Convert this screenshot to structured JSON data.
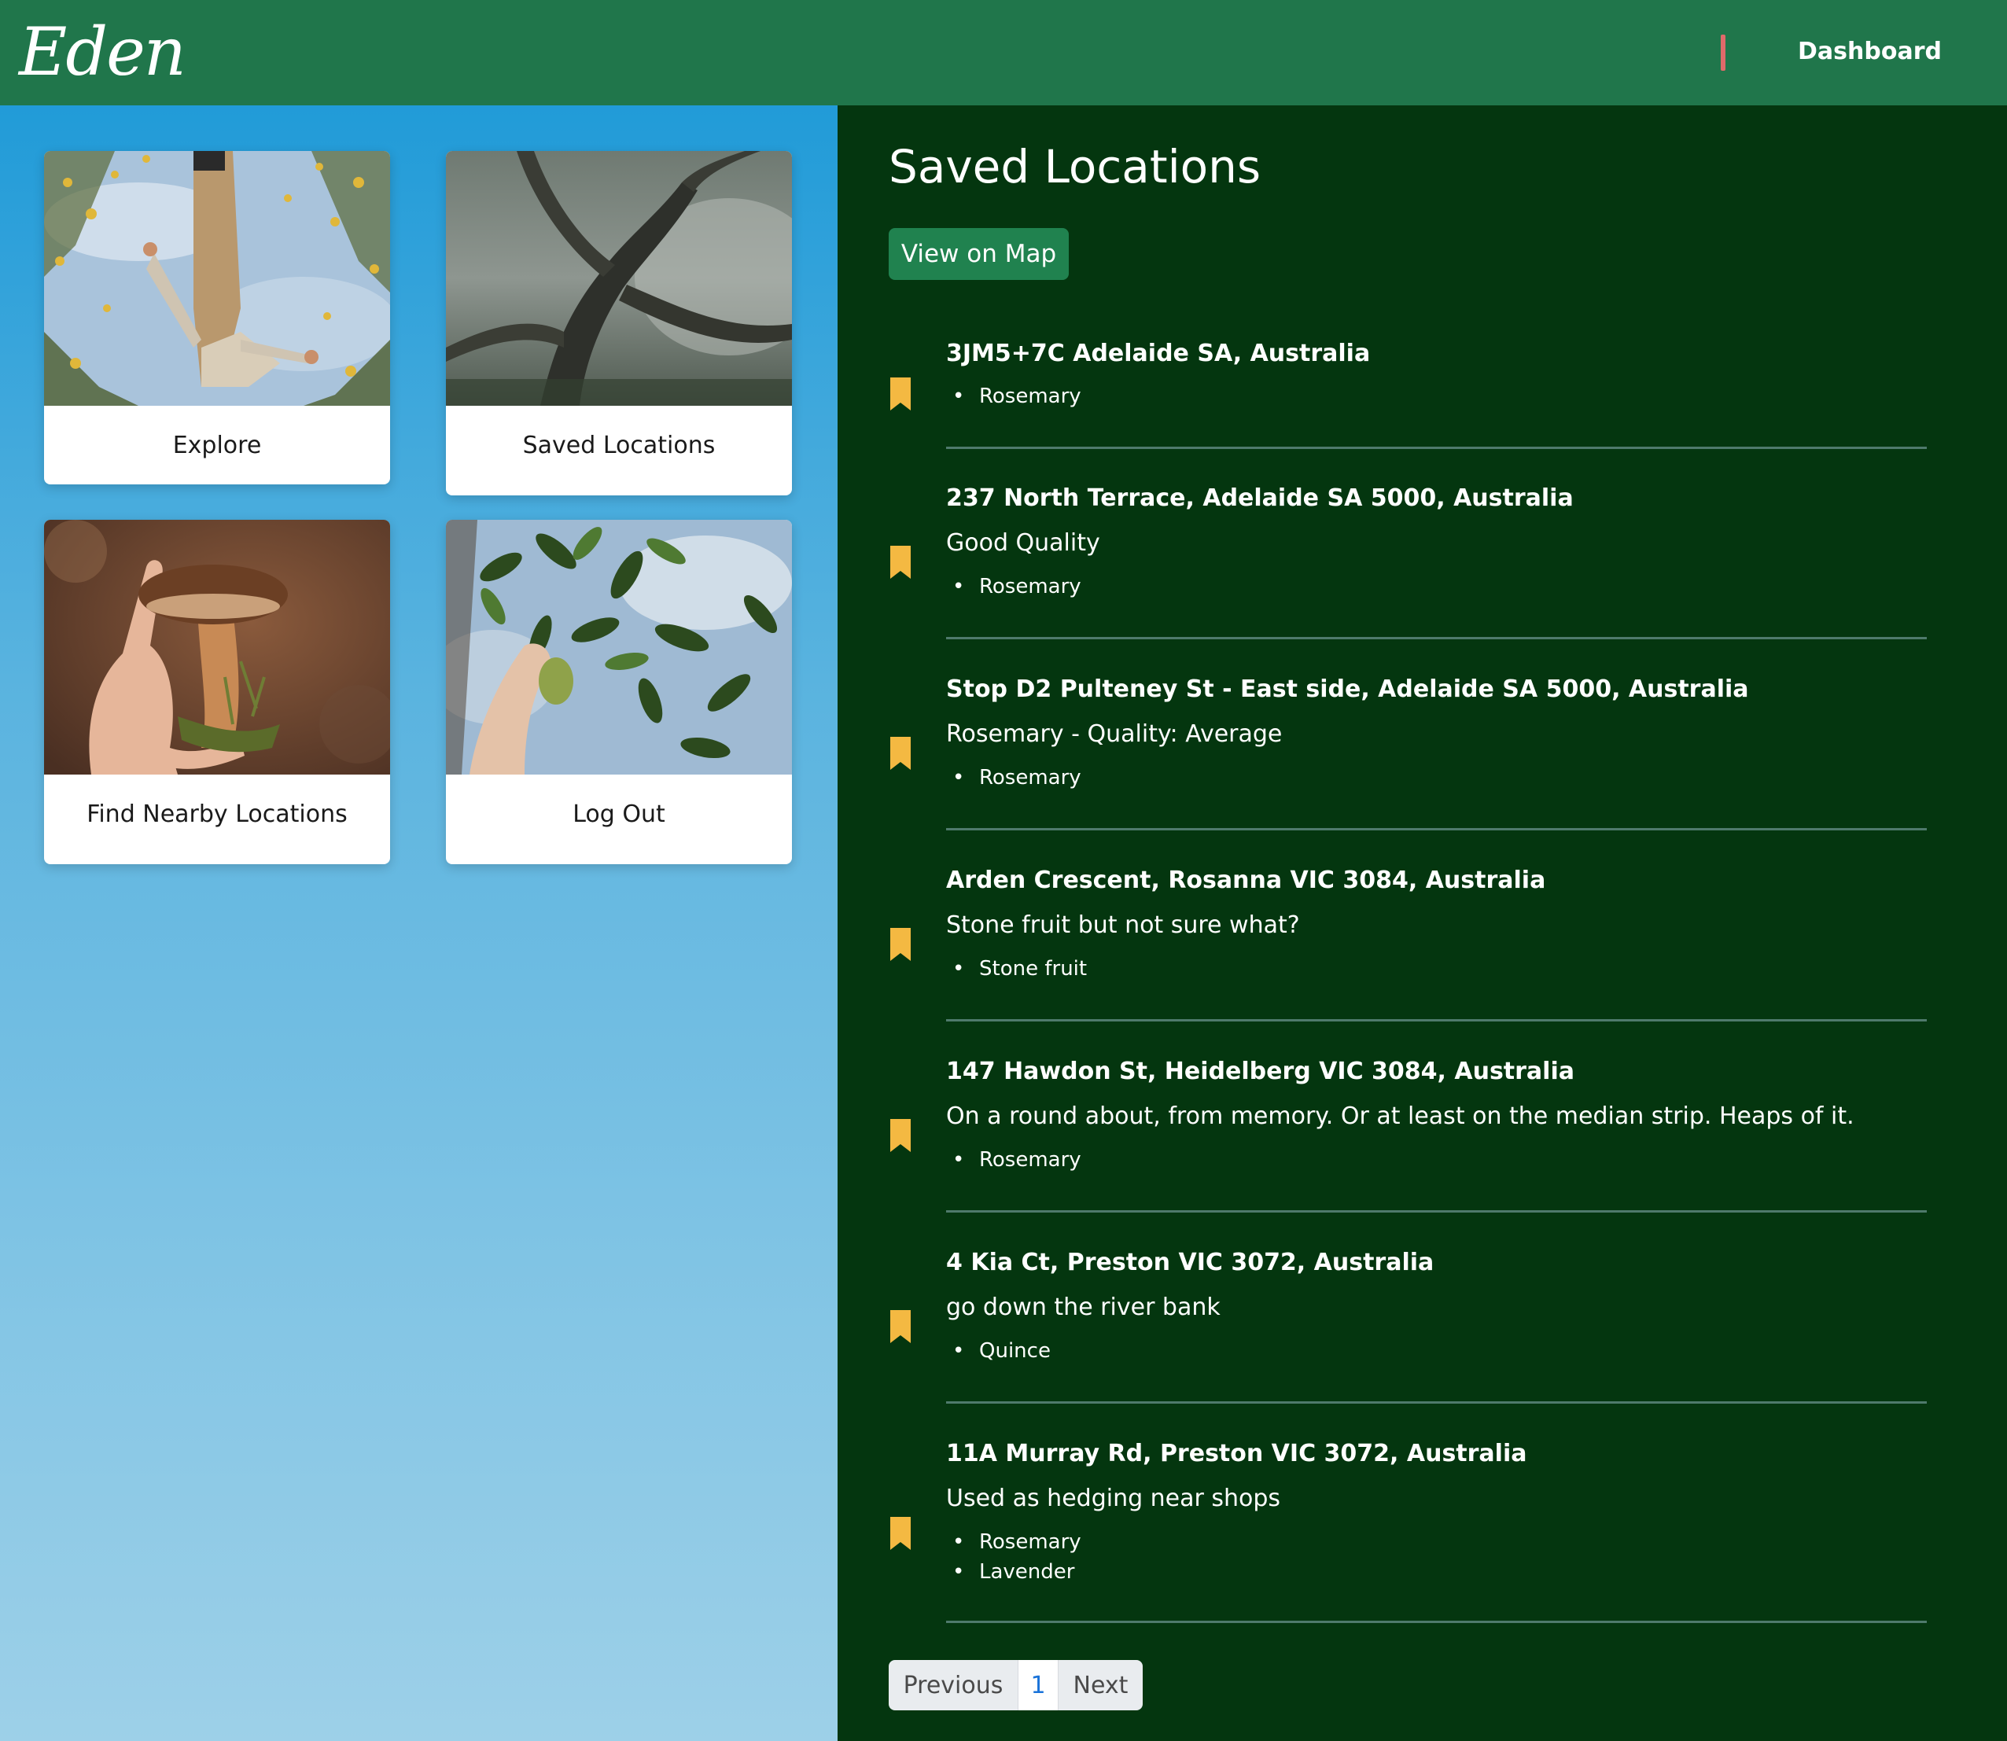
{
  "header": {
    "logo": "Eden",
    "nav_link": "Dashboard"
  },
  "menu_cards": [
    {
      "label": "Explore",
      "image": "person-among-yellow-flowers"
    },
    {
      "label": "Saved Locations",
      "image": "misty-twisted-tree"
    },
    {
      "label": "Find Nearby Locations",
      "image": "hand-holding-mushroom"
    },
    {
      "label": "Log Out",
      "image": "hand-picking-fruit"
    }
  ],
  "main": {
    "title": "Saved Locations",
    "map_button": "View on Map",
    "entries": [
      {
        "title": "3JM5+7C Adelaide SA, Australia",
        "description": "",
        "tags": [
          "Rosemary"
        ]
      },
      {
        "title": "237 North Terrace, Adelaide SA 5000, Australia",
        "description": "Good Quality",
        "tags": [
          "Rosemary"
        ]
      },
      {
        "title": "Stop D2 Pulteney St - East side, Adelaide SA 5000, Australia",
        "description": "Rosemary - Quality: Average",
        "tags": [
          "Rosemary"
        ]
      },
      {
        "title": "Arden Crescent, Rosanna VIC 3084, Australia",
        "description": "Stone fruit but not sure what?",
        "tags": [
          "Stone fruit"
        ]
      },
      {
        "title": "147 Hawdon St, Heidelberg VIC 3084, Australia",
        "description": "On a round about, from memory. Or at least on the median strip. Heaps of it.",
        "tags": [
          "Rosemary"
        ]
      },
      {
        "title": "4 Kia Ct, Preston VIC 3072, Australia",
        "description": "go down the river bank",
        "tags": [
          "Quince"
        ]
      },
      {
        "title": "11A Murray Rd, Preston VIC 3072, Australia",
        "description": "Used as hedging near shops",
        "tags": [
          "Rosemary",
          "Lavender"
        ]
      }
    ]
  },
  "pagination": {
    "previous": "Previous",
    "current": "1",
    "next": "Next"
  },
  "colors": {
    "header_bg": "#20764b",
    "panel_bg": "#04360f",
    "bookmark": "#f4b942",
    "button_bg": "#20824f"
  }
}
